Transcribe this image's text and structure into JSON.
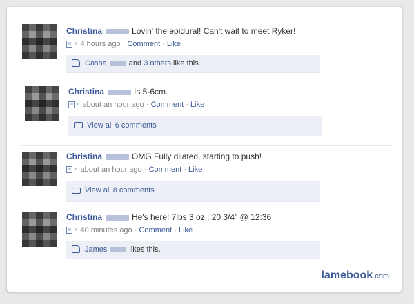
{
  "posts": [
    {
      "author": "Christina",
      "message": "Lovin' the epidural! Can't wait to meet Ryker!",
      "time": "4 hours ago",
      "comment_label": "Comment",
      "like_label": "Like",
      "likes": {
        "name": "Casha",
        "conjunction": "and",
        "others": "3 others",
        "suffix": "like this."
      }
    },
    {
      "author": "Christina",
      "message": "Is 5-6cm.",
      "time": "about an hour ago",
      "comment_label": "Comment",
      "like_label": "Like",
      "comments": "View all 6 comments"
    },
    {
      "author": "Christina",
      "message": "OMG Fully dilated, starting to push!",
      "time": "about an hour ago",
      "comment_label": "Comment",
      "like_label": "Like",
      "comments": "View all 8 comments"
    },
    {
      "author": "Christina",
      "message": "He's here! 7lbs 3 oz , 20 3/4\" @ 12:36",
      "time": "40 minutes ago",
      "comment_label": "Comment",
      "like_label": "Like",
      "likes": {
        "name": "James",
        "suffix": "likes this."
      }
    }
  ],
  "separator": "·",
  "mobile_icon": "mobile-upload-icon",
  "brand": {
    "name": "lamebook",
    "tld": ".com"
  },
  "colors": {
    "link": "#3b5998",
    "box_bg": "#eceff5",
    "page_bg": "#e9e9e9"
  }
}
